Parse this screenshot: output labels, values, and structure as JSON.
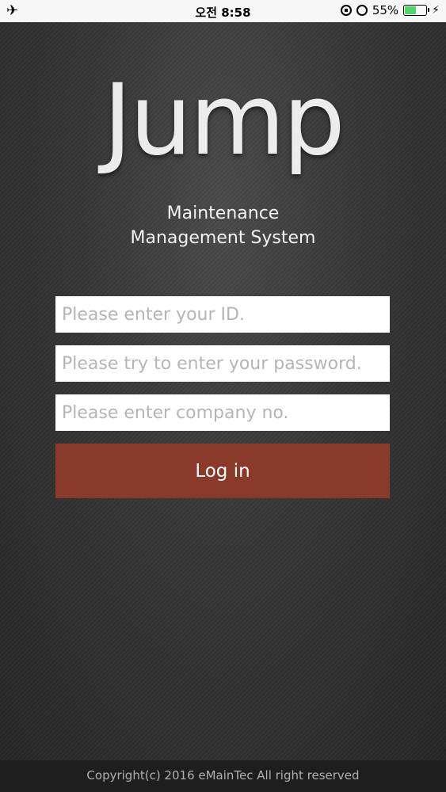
{
  "status_bar": {
    "airplane_icon": "airplane-icon",
    "time": "오전 8:58",
    "battery_percent": "55%",
    "battery_level": 0.55,
    "battery_color": "#4cd964"
  },
  "app": {
    "logo": "Jump",
    "subtitle_line1": "Maintenance",
    "subtitle_line2": "Management System"
  },
  "form": {
    "id_placeholder": "Please enter your ID.",
    "id_value": "",
    "password_placeholder": "Please try to enter your password.",
    "password_value": "",
    "company_placeholder": "Please enter company no.",
    "company_value": "",
    "login_label": "Log in",
    "login_color": "#8a3a2a"
  },
  "footer": {
    "copyright": "Copyright(c) 2016 eMainTec All right reserved"
  }
}
